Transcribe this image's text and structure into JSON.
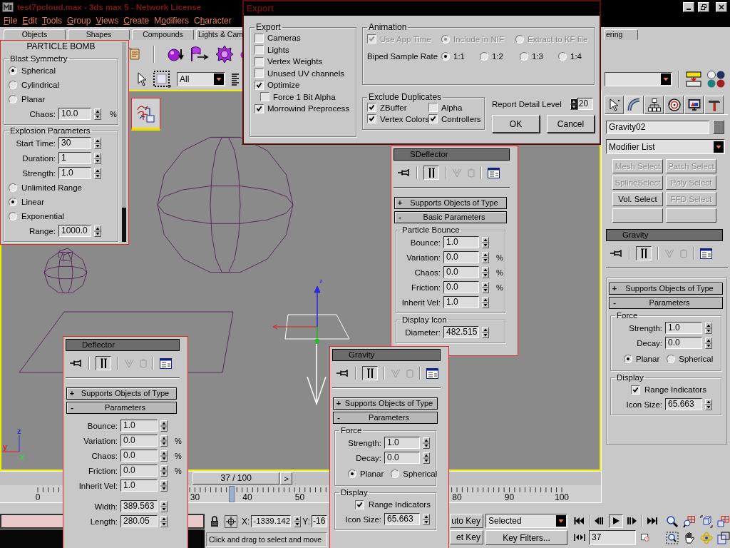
{
  "window": {
    "title": "test7pcloud.max - 3ds max 5 - Network License"
  },
  "menu": [
    {
      "mnemonic": "F",
      "rest": "ile"
    },
    {
      "mnemonic": "E",
      "rest": "dit"
    },
    {
      "mnemonic": "T",
      "rest": "ools"
    },
    {
      "mnemonic": "G",
      "rest": "roup"
    },
    {
      "mnemonic": "V",
      "rest": "iews"
    },
    {
      "mnemonic": "C",
      "rest": "reate"
    },
    {
      "lead": "M",
      "mnemonic": "o",
      "rest": "difiers"
    },
    {
      "lead": "C",
      "mnemonic": "h",
      "rest": "aracter"
    }
  ],
  "tabs": [
    {
      "label": "Objects",
      "selected": false
    },
    {
      "label": "Shapes",
      "selected": false
    },
    {
      "label": "Compounds",
      "selected": false
    },
    {
      "label": "Lights & Cam",
      "selected": false
    },
    {
      "label": "ering",
      "selected": false
    }
  ],
  "toolbar": {
    "selection_filter": "All"
  },
  "particle_bomb": {
    "title": "PARTICLE BOMB",
    "groups": [
      {
        "title": "Blast Symmetry",
        "rows": [
          {
            "kind": "radio",
            "label": "Spherical",
            "selected": true
          },
          {
            "kind": "radio",
            "label": "Cylindrical",
            "selected": false
          },
          {
            "kind": "radio",
            "label": "Planar",
            "selected": false
          },
          {
            "kind": "spinner",
            "label": "Chaos:",
            "value": "10.0",
            "unit": "%"
          }
        ]
      },
      {
        "title": "Explosion Parameters",
        "rows": [
          {
            "kind": "spinner",
            "label": "Start Time:",
            "value": "30"
          },
          {
            "kind": "spinner",
            "label": "Duration:",
            "value": "1"
          },
          {
            "kind": "spinner",
            "label": "Strength:",
            "value": "1.0"
          },
          {
            "kind": "radio",
            "label": "Unlimited Range",
            "selected": false
          },
          {
            "kind": "radio",
            "label": "Linear",
            "selected": true
          },
          {
            "kind": "radio",
            "label": "Exponential",
            "selected": false
          },
          {
            "kind": "spinner",
            "label": "Range:",
            "value": "1000.0"
          }
        ]
      }
    ]
  },
  "export_dialog": {
    "title": "Export",
    "export_group": {
      "title": "Export",
      "options": [
        {
          "label": "Cameras",
          "checked": false
        },
        {
          "label": "Lights",
          "checked": false
        },
        {
          "label": "Vertex Weights",
          "checked": false
        },
        {
          "label": "Unused UV channels",
          "checked": false
        },
        {
          "label": "Optimize",
          "checked": true,
          "children": [
            {
              "label": "Force 1 Bit Alpha",
              "checked": false
            }
          ]
        },
        {
          "label": "Morrowind Preprocess",
          "checked": true
        }
      ]
    },
    "animation": {
      "title": "Animation",
      "use_app_time": {
        "label": "Use App Time",
        "checked": true,
        "disabled": true
      },
      "keyframe_modes": [
        {
          "label": "Include in NIF",
          "selected": true,
          "disabled": true
        },
        {
          "label": "Extract to KF file",
          "selected": false,
          "disabled": true
        }
      ],
      "sample_rate_label": "Biped Sample Rate",
      "sample_rates": [
        {
          "label": "1:1",
          "selected": true
        },
        {
          "label": "1:2",
          "selected": false
        },
        {
          "label": "1:3",
          "selected": false
        },
        {
          "label": "1:4",
          "selected": false
        }
      ]
    },
    "exclude_duplicates": {
      "title": "Exclude Duplicates",
      "options": [
        {
          "label": "ZBuffer",
          "checked": true
        },
        {
          "label": "Alpha",
          "checked": false
        },
        {
          "label": "Vertex Colors",
          "checked": true
        },
        {
          "label": "Controllers",
          "checked": true
        }
      ]
    },
    "report_detail": {
      "label": "Report Detail Level",
      "value": "20"
    },
    "buttons": [
      "OK",
      "Cancel"
    ]
  },
  "viewport": {
    "gizmo_axis": "z",
    "tripod": [
      {
        "label": "z",
        "color": "#2a2ae0"
      },
      {
        "label": "y",
        "color": "#e02020"
      },
      {
        "label": "x",
        "color": "#30e030"
      }
    ]
  },
  "panels": [
    {
      "title": "SDeflector",
      "stack_buttons": [
        {
          "pressed": false,
          "disabled": false
        },
        {
          "pressed": true,
          "disabled": false
        },
        {
          "pressed": false,
          "disabled": true
        },
        {
          "pressed": false,
          "disabled": true
        },
        {
          "pressed": false,
          "disabled": false
        }
      ],
      "rollouts": [
        {
          "sign": "+",
          "label": "Supports Objects of Type"
        },
        {
          "sign": "-",
          "label": "Basic Parameters"
        }
      ],
      "groups": [
        {
          "title": "Particle Bounce",
          "rows": [
            {
              "kind": "spinner",
              "label": "Bounce:",
              "value": "1.0"
            },
            {
              "kind": "spinner",
              "label": "Variation:",
              "value": "0.0",
              "unit": "%"
            },
            {
              "kind": "spinner",
              "label": "Chaos:",
              "value": "0.0",
              "unit": "%"
            },
            {
              "kind": "spinner",
              "label": "Friction:",
              "value": "0.0",
              "unit": "%"
            },
            {
              "kind": "spinner",
              "label": "Inherit Vel:",
              "value": "1.0"
            }
          ]
        },
        {
          "title": "Display Icon",
          "rows": [
            {
              "kind": "spinner",
              "label": "Diameter:",
              "value": "482.515"
            }
          ]
        }
      ]
    },
    {
      "title": "Deflector",
      "stack_buttons": [
        {
          "pressed": false,
          "disabled": false
        },
        {
          "pressed": true,
          "disabled": false
        },
        {
          "pressed": false,
          "disabled": true
        },
        {
          "pressed": false,
          "disabled": true
        },
        {
          "pressed": false,
          "disabled": false
        }
      ],
      "rollouts": [
        {
          "sign": "+",
          "label": "Supports Objects of Type"
        },
        {
          "sign": "-",
          "label": "Parameters"
        }
      ],
      "groups": [
        {
          "rows": [
            {
              "kind": "spinner",
              "label": "Bounce:",
              "value": "1.0"
            },
            {
              "kind": "spinner",
              "label": "Variation:",
              "value": "0.0",
              "unit": "%"
            },
            {
              "kind": "spinner",
              "label": "Chaos:",
              "value": "0.0",
              "unit": "%"
            },
            {
              "kind": "spinner",
              "label": "Friction:",
              "value": "0.0",
              "unit": "%"
            },
            {
              "kind": "spinner",
              "label": "Inherit Vel:",
              "value": "1.0"
            }
          ]
        },
        {
          "rows": [
            {
              "kind": "spinner",
              "label": "Width:",
              "value": "389.563"
            },
            {
              "kind": "spinner",
              "label": "Length:",
              "value": "280.05"
            }
          ]
        }
      ]
    },
    {
      "title": "Gravity",
      "stack_buttons": [
        {
          "pressed": false,
          "disabled": false
        },
        {
          "pressed": true,
          "disabled": false
        },
        {
          "pressed": false,
          "disabled": true
        },
        {
          "pressed": false,
          "disabled": true
        },
        {
          "pressed": false,
          "disabled": false
        }
      ],
      "rollouts": [
        {
          "sign": "+",
          "label": "Supports Objects of Type"
        },
        {
          "sign": "-",
          "label": "Parameters"
        }
      ],
      "groups": [
        {
          "title": "Force",
          "rows": [
            {
              "kind": "spinner",
              "label": "Strength:",
              "value": "1.0"
            },
            {
              "kind": "spinner",
              "label": "Decay:",
              "value": "0.0"
            },
            {
              "kind": "radios",
              "options": [
                {
                  "label": "Planar",
                  "selected": true
                },
                {
                  "label": "Spherical",
                  "selected": false
                }
              ]
            }
          ]
        },
        {
          "title": "Display",
          "rows": [
            {
              "kind": "checkbox",
              "label": "Range Indicators",
              "checked": true
            },
            {
              "kind": "spinner",
              "label": "Icon Size:",
              "value": "65.663"
            }
          ]
        }
      ]
    }
  ],
  "command_panel": {
    "tabs": [
      {
        "selected": false
      },
      {
        "selected": true
      },
      {
        "selected": false
      },
      {
        "selected": false
      },
      {
        "selected": false
      },
      {
        "selected": false
      }
    ],
    "object_name": "Gravity02",
    "modifier_list": "Modifier List",
    "modifier_buttons": [
      {
        "kind": "button",
        "label": "Mesh Select",
        "disabled": true
      },
      {
        "kind": "button",
        "label": "Patch Select",
        "disabled": true
      },
      {
        "kind": "button",
        "label": "SplineSelect",
        "disabled": true
      },
      {
        "kind": "button",
        "label": "Poly Select",
        "disabled": true
      },
      {
        "kind": "button",
        "label": "Vol. Select",
        "disabled": false
      },
      {
        "kind": "button",
        "label": "FFD Select",
        "disabled": true
      },
      {
        "kind": "blank"
      },
      {
        "kind": "blank"
      }
    ],
    "stack": {
      "title": "Gravity",
      "stack_buttons": [
        {
          "pressed": false,
          "disabled": false
        },
        {
          "pressed": true,
          "disabled": false
        },
        {
          "pressed": false,
          "disabled": true
        },
        {
          "pressed": false,
          "disabled": true
        },
        {
          "pressed": false,
          "disabled": false
        }
      ],
      "rollouts": [
        {
          "sign": "+",
          "label": "Supports Objects of Type"
        },
        {
          "sign": "-",
          "label": "Parameters"
        }
      ],
      "groups": [
        {
          "title": "Force",
          "rows": [
            {
              "kind": "spinner",
              "label": "Strength:",
              "value": "1.0"
            },
            {
              "kind": "spinner",
              "label": "Decay:",
              "value": "0.0"
            },
            {
              "kind": "radios",
              "options": [
                {
                  "label": "Planar",
                  "selected": true
                },
                {
                  "label": "Spherical",
                  "selected": false
                }
              ]
            }
          ]
        },
        {
          "title": "Display",
          "rows": [
            {
              "kind": "checkbox",
              "label": "Range Indicators",
              "checked": true
            },
            {
              "kind": "spinner",
              "label": "Icon Size:",
              "value": "65.663"
            }
          ]
        }
      ]
    }
  },
  "timeline": {
    "position": "37 / 100",
    "level": 0.37,
    "next": ">",
    "frames": [
      "0",
      "30",
      "40",
      "50",
      "80",
      "90",
      "100"
    ]
  },
  "status": {
    "x_label": "X:",
    "x_value": "-1339.142",
    "y_label": "Y:",
    "y_value": "-16",
    "prompt": "Click and drag to select and move"
  },
  "animation_controls": {
    "auto_key": "uto Key",
    "set_key": "et Key",
    "key_filter_mode": "Selected",
    "key_filters": "Key Filters...",
    "current_frame": "37"
  }
}
